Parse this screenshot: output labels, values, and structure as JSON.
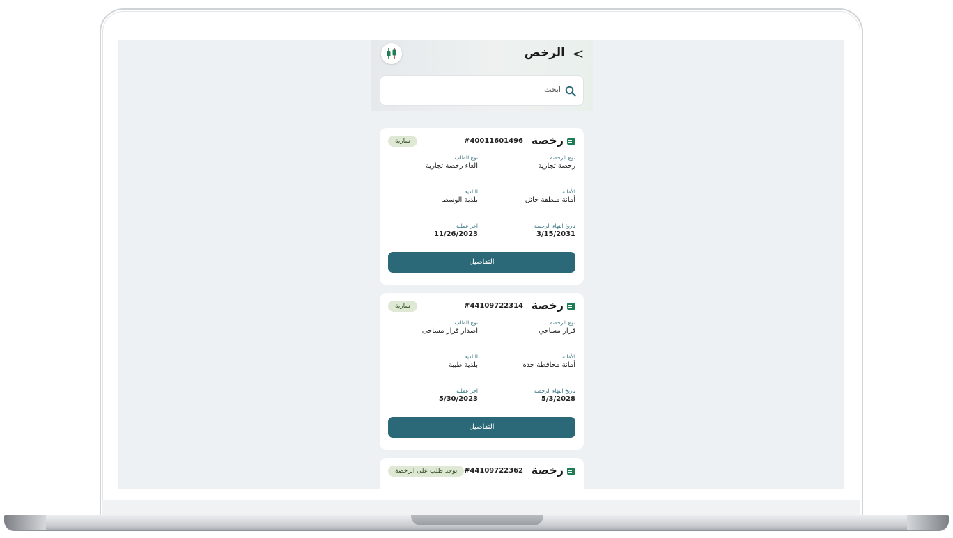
{
  "header": {
    "title": "الرخص",
    "back_glyph": "<"
  },
  "search": {
    "placeholder": "ابحث"
  },
  "licenses": [
    {
      "word": "رخصة",
      "number": "#40011601496",
      "status": "سارية",
      "type_label": "نوع الرخصة",
      "type_value": "رخصة تجارية",
      "request_label": "نوع الطلب",
      "request_value": "الغاء رخصة تجارية",
      "amanah_label": "الأمانة",
      "amanah_value": "أمانة منطقة حائل",
      "municipality_label": "البلدية",
      "municipality_value": "بلدية الوسط",
      "expiry_label": "تاريخ انتهاء الرخصة",
      "expiry_value": "3/15/2031",
      "last_op_label": "آخر عملية",
      "last_op_value": "11/26/2023",
      "details_label": "التفاصيل"
    },
    {
      "word": "رخصة",
      "number": "#44109722314",
      "status": "سارية",
      "type_label": "نوع الرخصة",
      "type_value": "قرار مساحي",
      "request_label": "نوع الطلب",
      "request_value": "اصدار قرار مساحى",
      "amanah_label": "الأمانة",
      "amanah_value": "أمانة محافظة جدة",
      "municipality_label": "البلدية",
      "municipality_value": "بلدية طيبة",
      "expiry_label": "تاريخ انتهاء الرخصة",
      "expiry_value": "5/3/2028",
      "last_op_label": "آخر عملية",
      "last_op_value": "5/30/2023",
      "details_label": "التفاصيل"
    },
    {
      "word": "رخصة",
      "number": "#44109722362",
      "status": "يوجد طلب على الرخصة"
    }
  ],
  "colors": {
    "primary_button": "#2b6878",
    "label_teal": "#2e6d7d",
    "badge_bg": "#dfe8d4",
    "license_icon": "#1e7d55"
  },
  "icons": {
    "back": "chevron-right-icon",
    "filter": "sliders-icon",
    "search": "search-icon",
    "license": "id-card-icon"
  }
}
